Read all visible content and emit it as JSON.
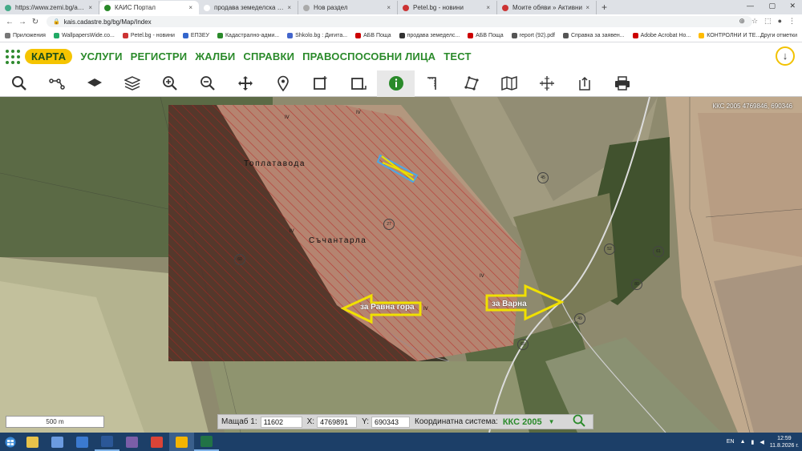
{
  "browser": {
    "tabs": [
      {
        "title": "https://www.zemi.bg/adv-search",
        "active": false,
        "fav": "#4a8"
      },
      {
        "title": "КАИС Портал",
        "active": true,
        "fav": "#2a8a2a"
      },
      {
        "title": "продава земеделска земя",
        "active": false,
        "fav": "#fff"
      },
      {
        "title": "Нов раздел",
        "active": false,
        "fav": "#aaa"
      },
      {
        "title": "Petel.bg - новини",
        "active": false,
        "fav": "#c33"
      },
      {
        "title": "Моите обяви » Активни",
        "active": false,
        "fav": "#c33"
      }
    ],
    "new_tab": "+",
    "close_glyph": "×",
    "window_controls": {
      "minimize": "—",
      "maximize": "▢",
      "close": "✕"
    },
    "back": "←",
    "forward": "→",
    "reload": "↻",
    "url": "kais.cadastre.bg/bg/Map/Index",
    "lock": "🔒",
    "bookmarks": [
      {
        "label": "Приложения",
        "color": "#777"
      },
      {
        "label": "WallpapersWide.co...",
        "color": "#2a6"
      },
      {
        "label": "Petel.bg - новини",
        "color": "#c33"
      },
      {
        "label": "ЕПЗЕУ",
        "color": "#36c"
      },
      {
        "label": "Кадастрално-адми...",
        "color": "#2a8a2a"
      },
      {
        "label": "Shkolo.bg : Дигита...",
        "color": "#46c"
      },
      {
        "label": "АБВ Поща",
        "color": "#c00"
      },
      {
        "label": "продава земеделс...",
        "color": "#333"
      },
      {
        "label": "АБВ Поща",
        "color": "#c00"
      },
      {
        "label": "report (92).pdf",
        "color": "#555"
      },
      {
        "label": "Справка за заявен...",
        "color": "#555"
      },
      {
        "label": "Adobe Acrobat Ho...",
        "color": "#c00"
      },
      {
        "label": "КОНТРОЛНИ И ТЕ...",
        "color": "#fb0"
      }
    ],
    "other_bookmarks": "Други отметки"
  },
  "app": {
    "menu": [
      {
        "label": "КАРТА",
        "active": true
      },
      {
        "label": "УСЛУГИ",
        "active": false
      },
      {
        "label": "РЕГИСТРИ",
        "active": false
      },
      {
        "label": "ЖАЛБИ",
        "active": false
      },
      {
        "label": "СПРАВКИ",
        "active": false
      },
      {
        "label": "ПРАВОСПОСОБНИ ЛИЦА",
        "active": false
      },
      {
        "label": "ТЕСТ",
        "active": false
      }
    ],
    "download_glyph": "↓",
    "tools": [
      "search-icon",
      "route-icon",
      "layer-icon",
      "layers-stack-icon",
      "zoom-in-icon",
      "zoom-out-icon",
      "pan-icon",
      "marker-icon",
      "select-rect-icon",
      "select-area-icon",
      "info-icon",
      "measure-icon",
      "polygon-icon",
      "map-book-icon",
      "crosshair-icon",
      "export-icon",
      "print-icon"
    ],
    "active_tool": "info-icon"
  },
  "map": {
    "crs_label": "ККС 2005 4769846, 690346",
    "place_labels": [
      "Топлатавода",
      "Съчантарла"
    ],
    "parcel_numbers": [
      "27",
      "45",
      "49",
      "52",
      "60",
      "61",
      "80",
      "66"
    ],
    "region_marks": [
      "IV",
      "IV",
      "IV",
      "IV",
      "IV"
    ],
    "arrows": {
      "left": "за Равна гора",
      "right": "за Варна"
    },
    "scale": "500 m"
  },
  "status": {
    "scale_label": "Мащаб 1:",
    "scale_value": "11602",
    "x_label": "X:",
    "x_value": "4769891",
    "y_label": "Y:",
    "y_value": "690343",
    "crs_label": "Координатна система:",
    "crs_value": "ККС 2005",
    "dropdown_glyph": "▼"
  },
  "taskbar": {
    "apps": [
      {
        "name": "file-explorer",
        "color": "#e8c24a",
        "state": ""
      },
      {
        "name": "media-player",
        "color": "#6b9be0",
        "state": ""
      },
      {
        "name": "windows-media",
        "color": "#3b7ad0",
        "state": ""
      },
      {
        "name": "word",
        "color": "#2b5797",
        "state": "open"
      },
      {
        "name": "viber",
        "color": "#7b5ea8",
        "state": ""
      },
      {
        "name": "chrome",
        "color": "#db4437",
        "state": ""
      },
      {
        "name": "chrome-active",
        "color": "#f4b400",
        "state": "active"
      },
      {
        "name": "excel",
        "color": "#217346",
        "state": "open"
      }
    ],
    "lang": "EN",
    "time": "12:59",
    "date": "11.8.2026 г."
  }
}
